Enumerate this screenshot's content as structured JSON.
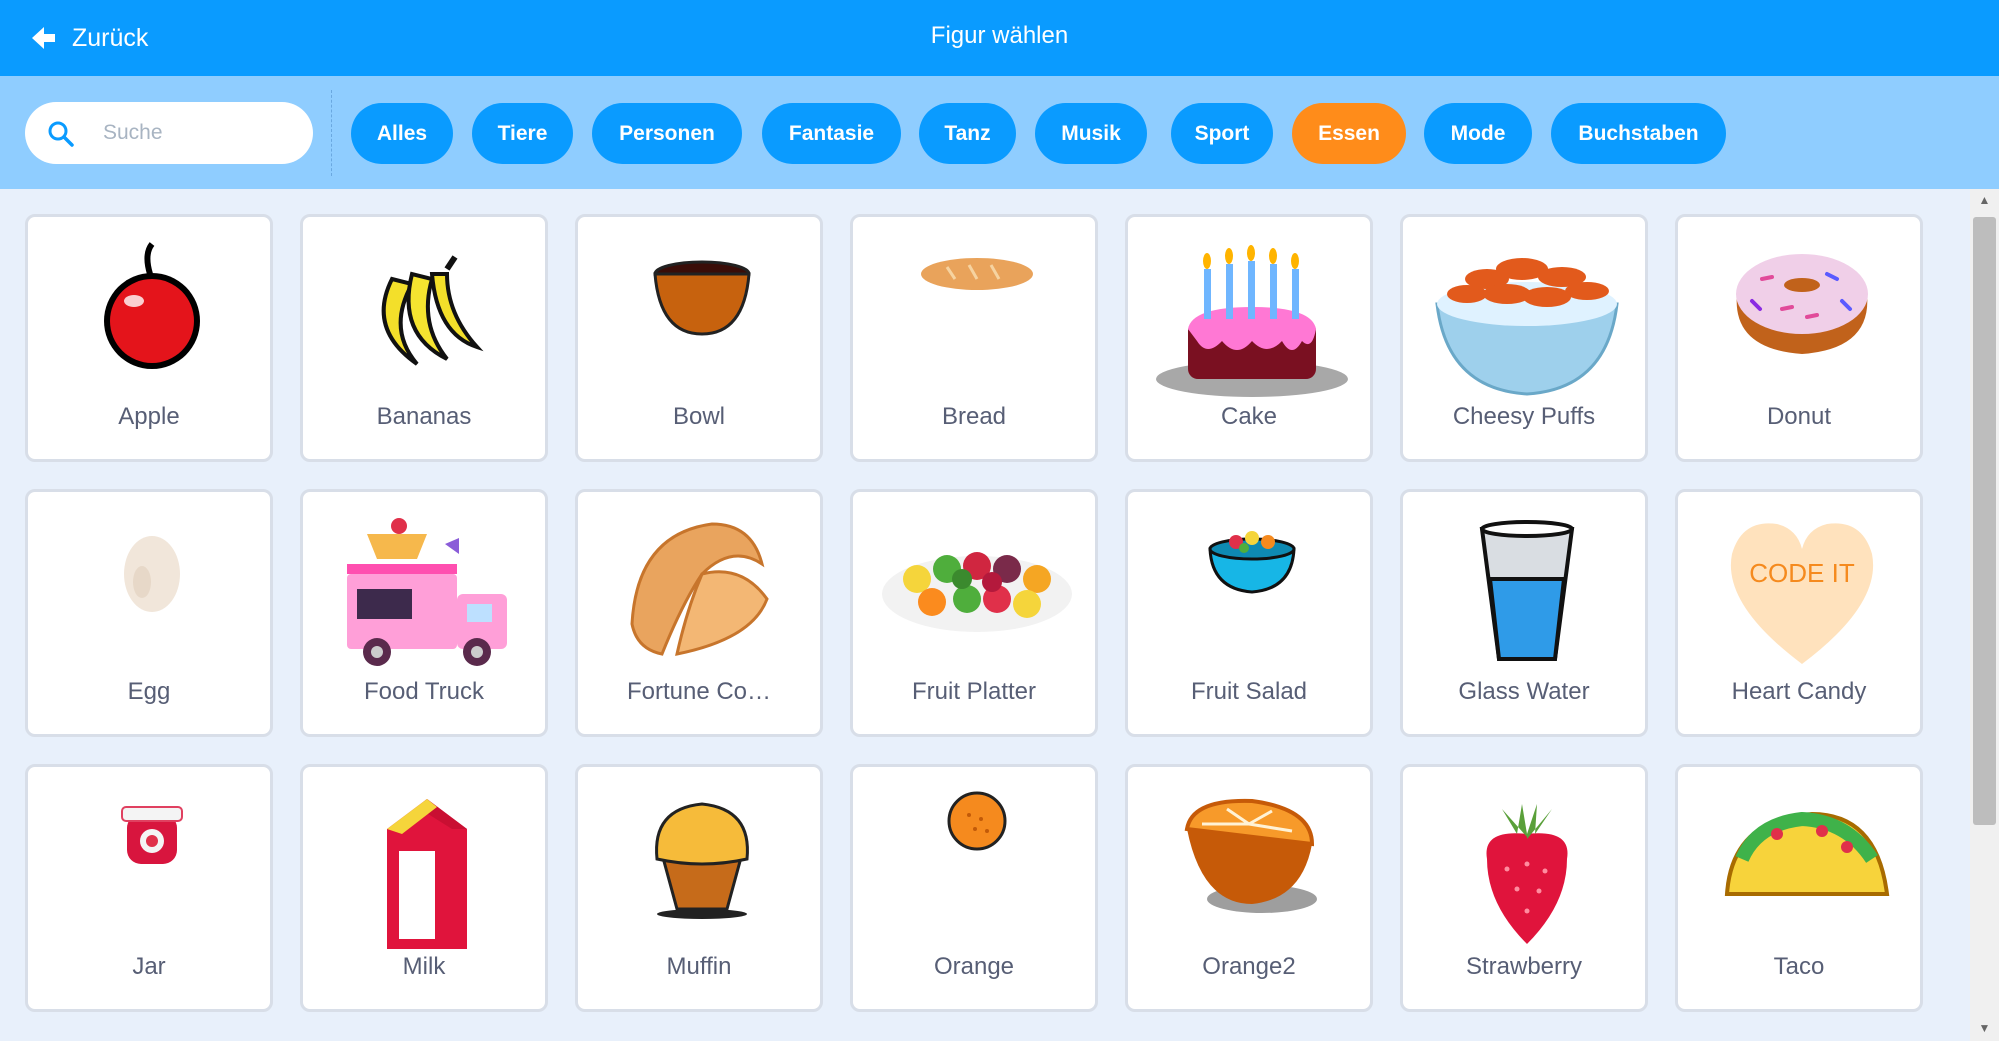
{
  "header": {
    "back_label": "Zurück",
    "title": "Figur wählen"
  },
  "search": {
    "placeholder": "Suche",
    "value": ""
  },
  "categories": [
    {
      "label": "Alles",
      "active": false
    },
    {
      "label": "Tiere",
      "active": false
    },
    {
      "label": "Personen",
      "active": false
    },
    {
      "label": "Fantasie",
      "active": false
    },
    {
      "label": "Tanz",
      "active": false
    },
    {
      "label": "Musik",
      "active": false
    },
    {
      "label": "Sport",
      "active": false
    },
    {
      "label": "Essen",
      "active": true
    },
    {
      "label": "Mode",
      "active": false
    },
    {
      "label": "Buchstaben",
      "active": false
    }
  ],
  "colors": {
    "header": "#0a9bff",
    "filterbar": "#8fcdff",
    "active_chip": "#ff8c1a",
    "chip": "#0a9bff"
  },
  "sprites": [
    {
      "name": "Apple",
      "icon": "apple"
    },
    {
      "name": "Bananas",
      "icon": "bananas"
    },
    {
      "name": "Bowl",
      "icon": "bowl"
    },
    {
      "name": "Bread",
      "icon": "bread"
    },
    {
      "name": "Cake",
      "icon": "cake"
    },
    {
      "name": "Cheesy Puffs",
      "icon": "cheesy-puffs"
    },
    {
      "name": "Donut",
      "icon": "donut"
    },
    {
      "name": "Egg",
      "icon": "egg"
    },
    {
      "name": "Food Truck",
      "icon": "food-truck"
    },
    {
      "name": "Fortune Co…",
      "icon": "fortune-cookie"
    },
    {
      "name": "Fruit Platter",
      "icon": "fruit-platter"
    },
    {
      "name": "Fruit Salad",
      "icon": "fruit-salad"
    },
    {
      "name": "Glass Water",
      "icon": "glass-water"
    },
    {
      "name": "Heart Candy",
      "icon": "heart-candy",
      "text": "CODE IT"
    },
    {
      "name": "Jar",
      "icon": "jar"
    },
    {
      "name": "Milk",
      "icon": "milk"
    },
    {
      "name": "Muffin",
      "icon": "muffin"
    },
    {
      "name": "Orange",
      "icon": "orange"
    },
    {
      "name": "Orange2",
      "icon": "orange2"
    },
    {
      "name": "Strawberry",
      "icon": "strawberry"
    },
    {
      "name": "Taco",
      "icon": "taco"
    }
  ]
}
